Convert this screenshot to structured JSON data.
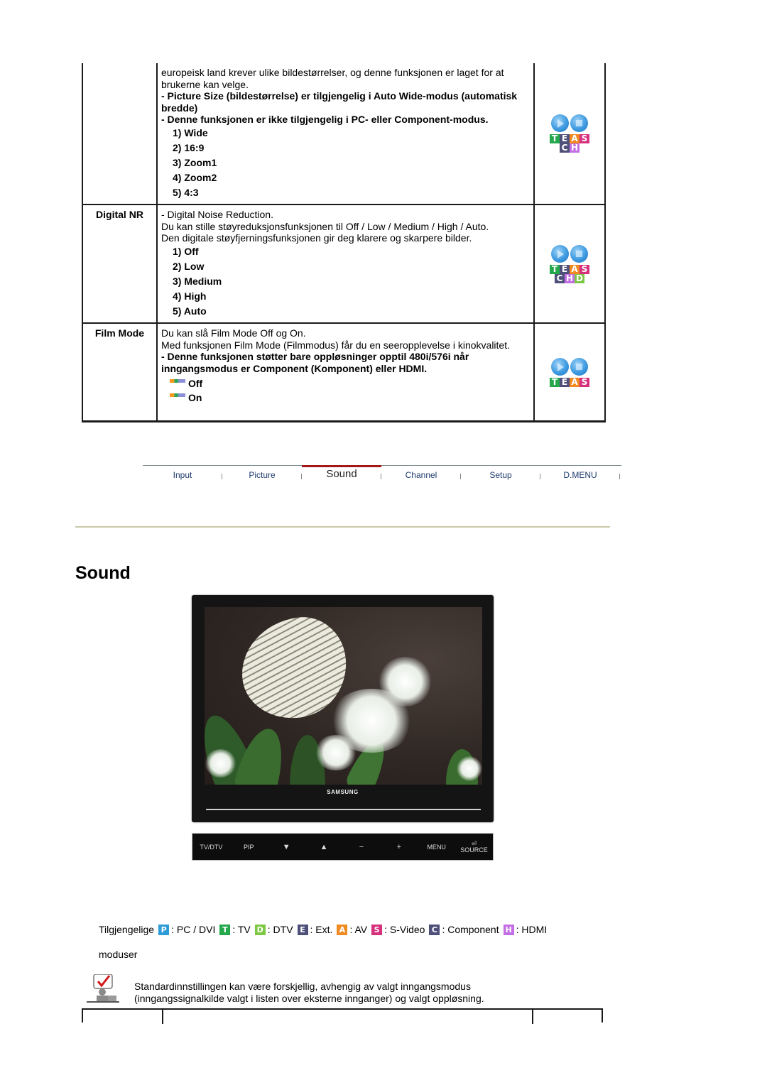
{
  "colors": {
    "T": "#25a84c",
    "E": "#4e5079",
    "A": "#f28a22",
    "S": "#d6307d",
    "C": "#4e5079",
    "H": "#c36fe3",
    "D": "#7cc845",
    "P": "#2c9cd8",
    "nav_active": "#a01818"
  },
  "table": {
    "rows": [
      {
        "label": "",
        "text": [
          "europeisk land krever ulike bildestørrelser, og denne funksjonen er laget for at brukerne kan velge."
        ],
        "bold_text": [
          "- Picture Size (bildestørrelse) er tilgjengelig i Auto Wide-modus (automatisk bredde)",
          "- Denne funksjonen er ikke tilgjengelig i PC- eller Component-modus."
        ],
        "options": [
          "1) Wide",
          "2) 16:9",
          "3) Zoom1",
          "4) Zoom2",
          "5) 4:3"
        ],
        "icons": {
          "row1": [
            "T",
            "E",
            "A",
            "S"
          ],
          "row2": [
            "C",
            "H"
          ]
        }
      },
      {
        "label": "Digital NR",
        "text": [
          "- Digital Noise Reduction.",
          "Du kan stille støyreduksjonsfunksjonen til Off / Low / Medium / High / Auto.",
          "Den digitale støyfjerningsfunksjonen gir deg klarere og skarpere bilder."
        ],
        "options": [
          "1) Off",
          "2) Low",
          "3) Medium",
          "4) High",
          "5) Auto"
        ],
        "icons": {
          "row1": [
            "T",
            "E",
            "A",
            "S"
          ],
          "row2": [
            "C",
            "H",
            "D"
          ]
        }
      },
      {
        "label": "Film Mode",
        "text": [
          "Du kan slå Film Mode Off og On.",
          "Med funksjonen Film Mode (Filmmodus) får du en seeropplevelse i kinokvalitet."
        ],
        "bold_text": [
          "- Denne funksjonen støtter bare oppløsninger opptil 480i/576i når inngangsmodus er Component (Komponent) eller HDMI."
        ],
        "options": [
          "Off",
          "On"
        ],
        "icons": {
          "row1": [
            "T",
            "E",
            "A",
            "S"
          ],
          "row2": []
        }
      }
    ]
  },
  "nav": {
    "items": [
      "Input",
      "Picture",
      "Sound",
      "Channel",
      "Setup",
      "D.MENU"
    ],
    "active": "Sound"
  },
  "section_title": "Sound",
  "monitor": {
    "brand": "SAMSUNG",
    "buttons": [
      "TV/DTV",
      "PIP",
      "▼",
      "▲",
      "−",
      "+",
      "MENU",
      "SOURCE"
    ]
  },
  "legend": {
    "prefix": "Tilgjengelige",
    "items": [
      {
        "key": "P",
        "label": ": PC / DVI"
      },
      {
        "key": "T",
        "label": ": TV"
      },
      {
        "key": "D",
        "label": ": DTV"
      },
      {
        "key": "E",
        "label": ": Ext."
      },
      {
        "key": "A",
        "label": ": AV"
      },
      {
        "key": "S",
        "label": ": S-Video"
      },
      {
        "key": "C",
        "label": ": Component"
      },
      {
        "key": "H",
        "label": ": HDMI"
      }
    ],
    "suffix": "moduser"
  },
  "note": {
    "lines": [
      "Standardinnstillingen kan være forskjellig, avhengig av valgt inngangsmodus",
      "(inngangssignalkilde valgt i listen over eksterne innganger) og valgt oppløsning."
    ]
  }
}
